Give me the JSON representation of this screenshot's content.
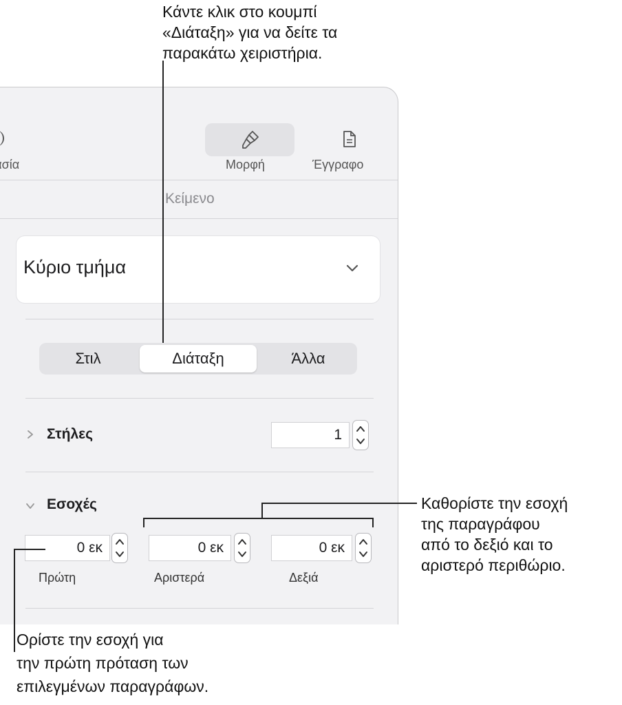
{
  "callouts": {
    "top": {
      "line1": "Κάντε κλικ στο κουμπί",
      "line2": "«Διάταξη» για να δείτε τα",
      "line3": "παρακάτω χειριστήρια."
    },
    "right": {
      "line1": "Καθορίστε την εσοχή",
      "line2": "της παραγράφου",
      "line3": "από το δεξιό και το",
      "line4": "αριστερό περιθώριο."
    },
    "bottom": {
      "line1": "Ορίστε την εσοχή για",
      "line2": "την πρώτη πρόταση των",
      "line3": "επιλεγμένων παραγράφων."
    }
  },
  "toolbar": {
    "partial_tab_label": "ρασία",
    "format_label": "Μορφή",
    "document_label": "Έγγραφο"
  },
  "section_title": "Κείμενο",
  "paragraph_style": {
    "value": "Κύριο τμήμα"
  },
  "segments": {
    "style": "Στιλ",
    "layout": "Διάταξη",
    "more": "Άλλα",
    "selected": "layout"
  },
  "columns": {
    "label": "Στήλες",
    "value": "1"
  },
  "indents": {
    "label": "Εσοχές",
    "first": {
      "value": "0 εκ",
      "label": "Πρώτη"
    },
    "left": {
      "value": "0 εκ",
      "label": "Αριστερά"
    },
    "right": {
      "value": "0 εκ",
      "label": "Δεξιά"
    }
  }
}
